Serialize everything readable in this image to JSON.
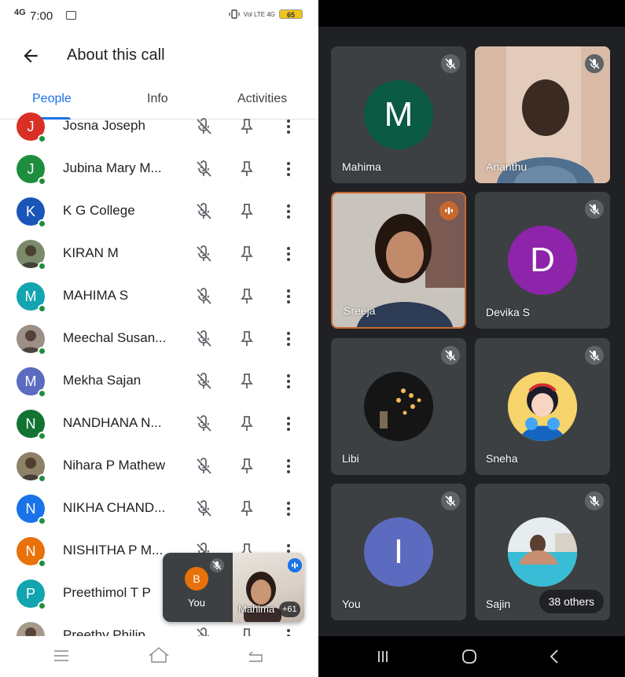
{
  "status": {
    "network": "4G",
    "time": "7:00",
    "battery": "65",
    "right_icons": "Vol LTE 4G"
  },
  "header": {
    "title": "About this call"
  },
  "tabs": [
    {
      "label": "People",
      "active": true
    },
    {
      "label": "Info",
      "active": false
    },
    {
      "label": "Activities",
      "active": false
    }
  ],
  "people": [
    {
      "name": "Josna Joseph",
      "initial": "J",
      "color": "#d93025"
    },
    {
      "name": "Jubina Mary M...",
      "initial": "J",
      "color": "#1e8e3e"
    },
    {
      "name": "K G College",
      "initial": "K",
      "color": "#1a56b8"
    },
    {
      "name": "KIRAN M",
      "initial": "",
      "color": "#7a8a6a"
    },
    {
      "name": "MAHIMA S",
      "initial": "M",
      "color": "#12a4af"
    },
    {
      "name": "Meechal Susan...",
      "initial": "",
      "color": "#9c8f86"
    },
    {
      "name": "Mekha Sajan",
      "initial": "M",
      "color": "#5c6bc0"
    },
    {
      "name": "NANDHANA N...",
      "initial": "N",
      "color": "#137333"
    },
    {
      "name": "Nihara P Mathew",
      "initial": "",
      "color": "#8d8168"
    },
    {
      "name": "NIKHA CHAND...",
      "initial": "N",
      "color": "#1a73e8"
    },
    {
      "name": "NISHITHA P M...",
      "initial": "N",
      "color": "#e8710a"
    },
    {
      "name": "Preethimol T P",
      "initial": "P",
      "color": "#12a4af"
    },
    {
      "name": "Preethy Philip",
      "initial": "",
      "color": "#a89a8a"
    }
  ],
  "pip": {
    "self_initial": "B",
    "self_label": "You",
    "other_name": "Mahima",
    "count": "+61"
  },
  "tiles": [
    {
      "name": "Mahima",
      "initial": "M",
      "color": "#0b5a43",
      "kind": "avatar",
      "muted": true
    },
    {
      "name": "Ananthu",
      "initial": "",
      "color": "",
      "kind": "video",
      "muted": true
    },
    {
      "name": "Sreeja",
      "initial": "",
      "color": "",
      "kind": "video",
      "muted": false
    },
    {
      "name": "Devika S",
      "initial": "D",
      "color": "#8e24aa",
      "kind": "avatar",
      "muted": true
    },
    {
      "name": "Libi",
      "initial": "",
      "color": "#1b1b1b",
      "kind": "photo",
      "muted": true
    },
    {
      "name": "Sneha",
      "initial": "",
      "color": "#f6d36b",
      "kind": "photo",
      "muted": true
    },
    {
      "name": "You",
      "initial": "I",
      "color": "#5c6bc0",
      "kind": "avatar",
      "muted": true
    },
    {
      "name": "Sajin",
      "initial": "",
      "color": "#4fc3d9",
      "kind": "photo",
      "muted": true
    }
  ],
  "others_label": "38 others",
  "colors": {
    "accent": "#1a73e8",
    "online": "#1e8e3e",
    "speaking": "#c8682f",
    "tile_bg": "#3c4043",
    "bg_dark": "#202124"
  }
}
